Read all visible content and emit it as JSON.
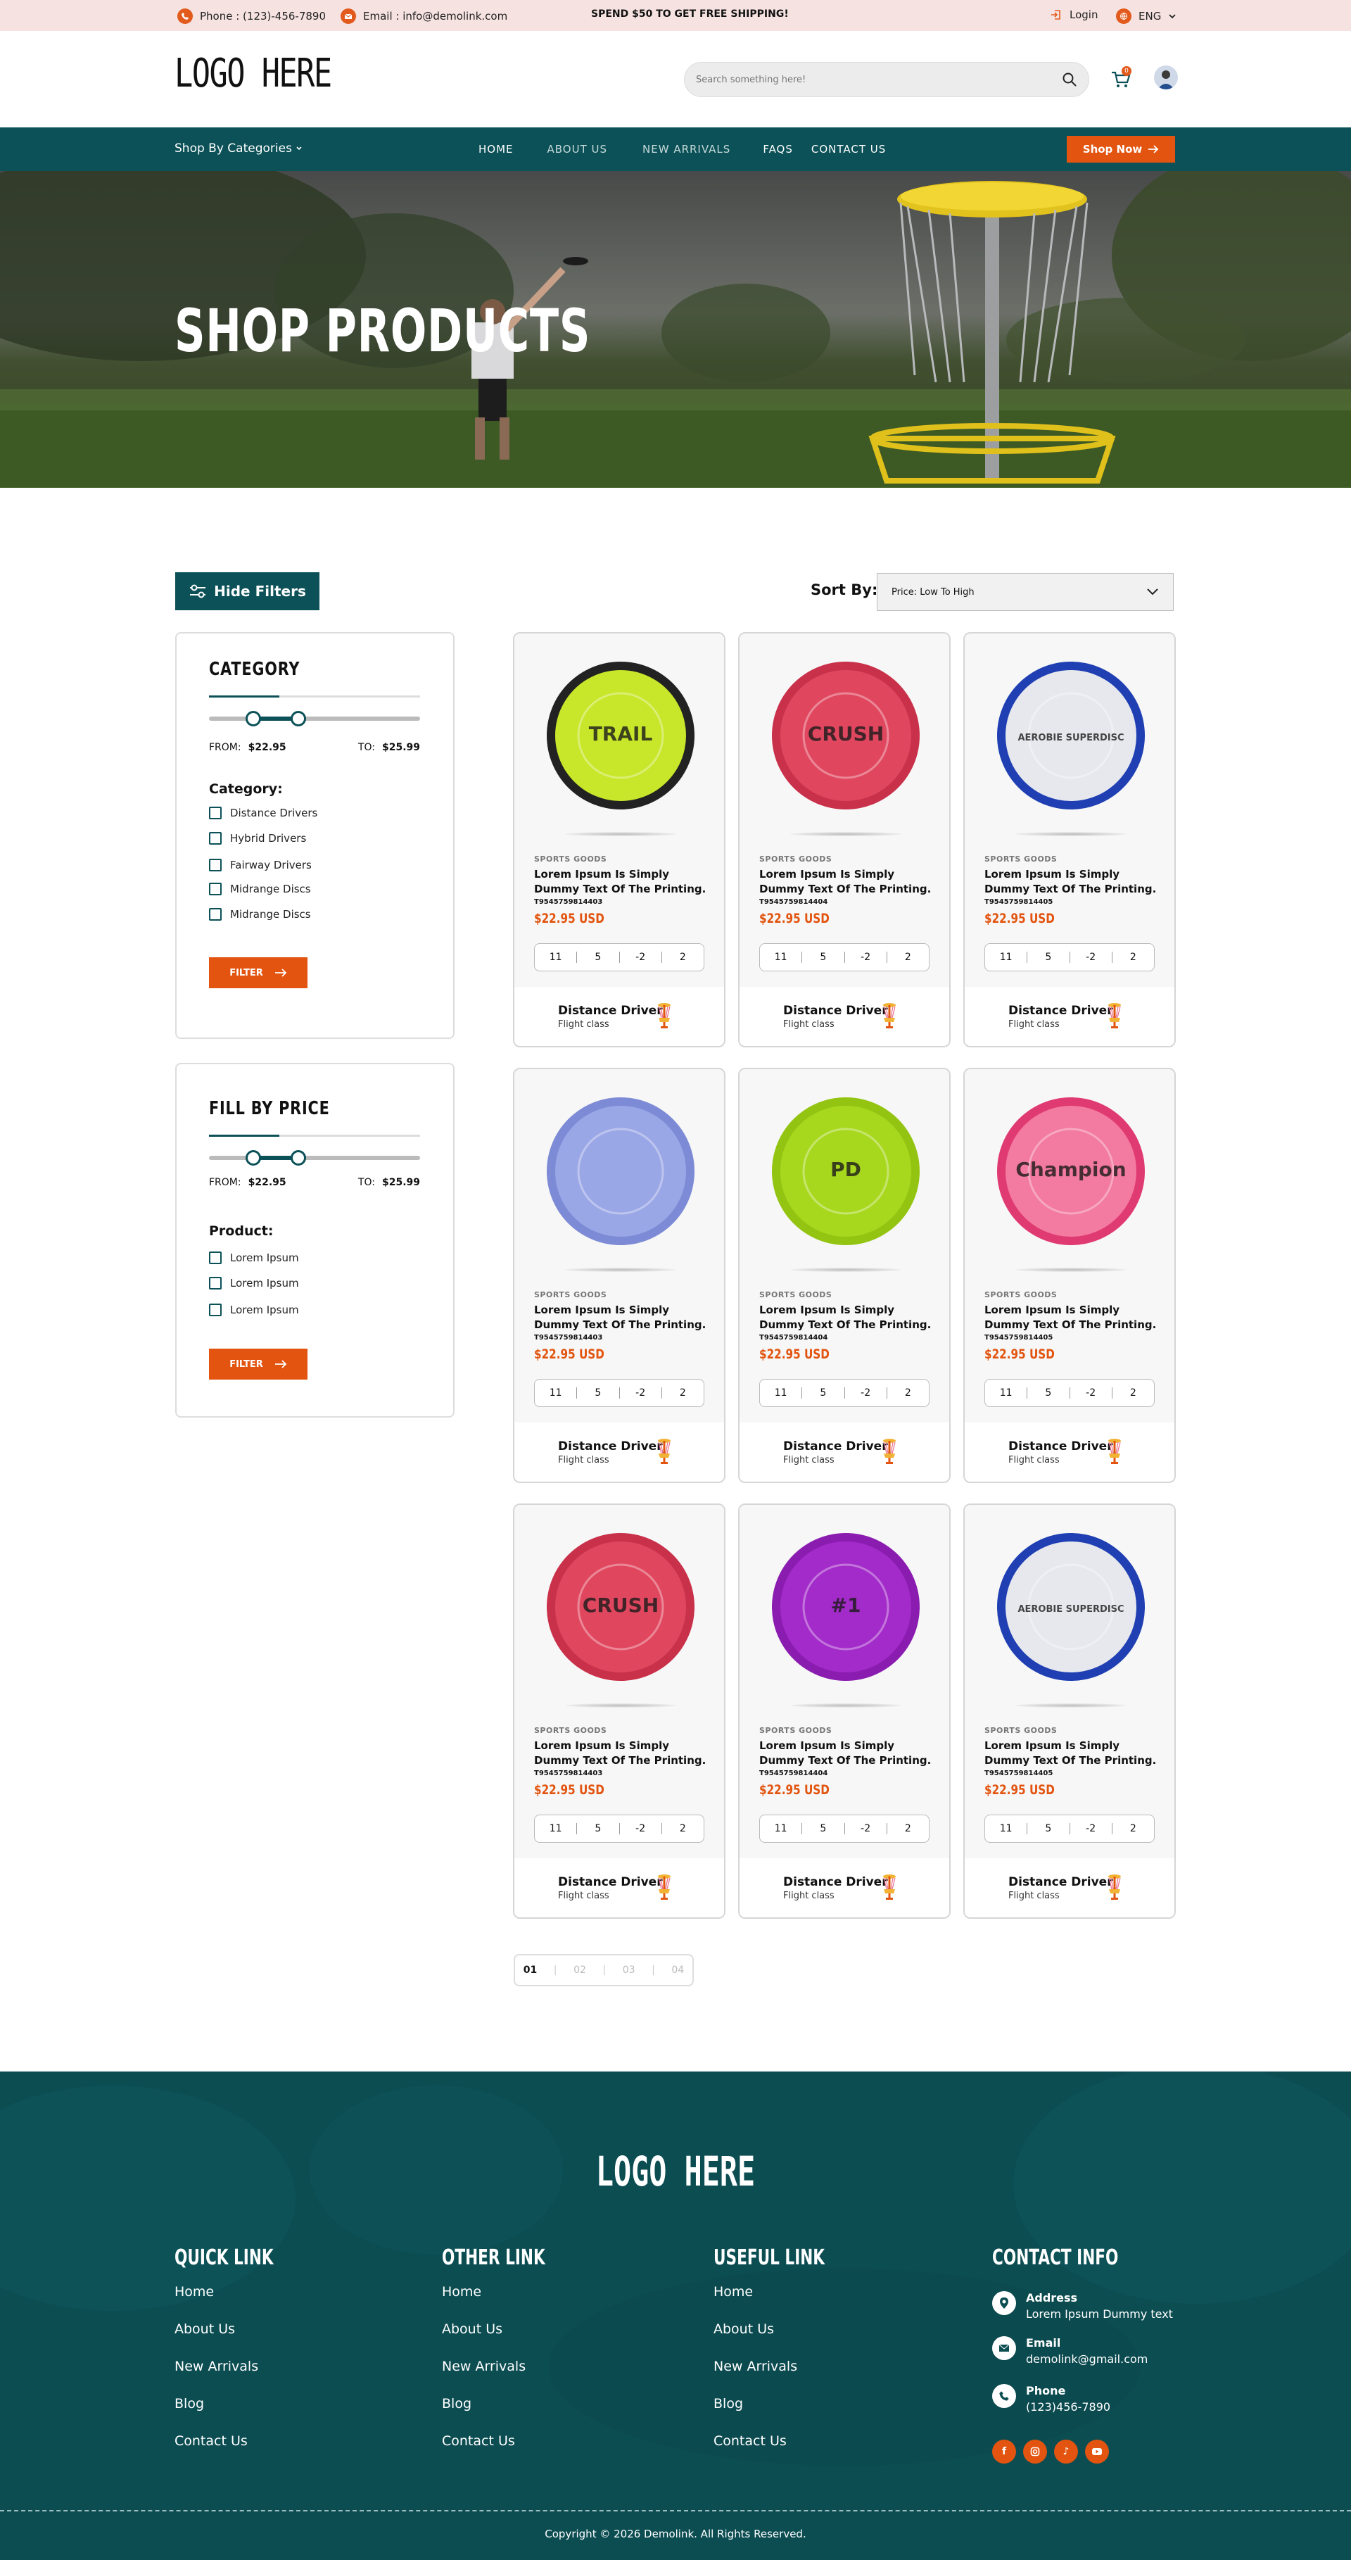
{
  "topbar": {
    "phone": "Phone : (123)-456-7890",
    "email": "Email : info@demolink.com",
    "promo": "SPEND $50 TO GET FREE SHIPPING!",
    "login": "Login",
    "language": "ENG"
  },
  "header": {
    "logo": "LOGO HERE",
    "search_placeholder": "Search something here!",
    "cart_count": "0"
  },
  "nav": {
    "categories_label": "Shop By Categories",
    "links": [
      "HOME",
      "ABOUT US",
      "NEW ARRIVALS",
      "FAQS",
      "CONTACT US"
    ],
    "shop_now": "Shop Now"
  },
  "hero": {
    "title": "SHOP PRODUCTS"
  },
  "toolbar": {
    "hide_filters": "Hide Filters",
    "sort_label": "Sort By:",
    "sort_value": "Price: Low To High"
  },
  "filter_category": {
    "heading": "CATEGORY",
    "from_label": "FROM:",
    "from_value": "$22.95",
    "to_label": "TO:",
    "to_value": "$25.99",
    "sublabel": "Category:",
    "options": [
      "Distance Drivers",
      "Hybrid Drivers",
      "Fairway Drivers",
      "Midrange Discs",
      "Midrange Discs"
    ],
    "button": "FILTER"
  },
  "filter_price": {
    "heading": "FILL BY PRICE",
    "from_label": "FROM:",
    "from_value": "$22.95",
    "to_label": "TO:",
    "to_value": "$25.99",
    "sublabel": "Product:",
    "options": [
      "Lorem Ipsum",
      "Lorem Ipsum",
      "Lorem Ipsum"
    ],
    "button": "FILTER"
  },
  "products": [
    {
      "category": "SPORTS GOODS",
      "title": "Lorem Ipsum Is Simply Dummy Text Of The Printing.",
      "sku": "T9545759814403",
      "price": "$22.95 USD",
      "stats": [
        "11",
        "5",
        "-2",
        "2"
      ],
      "driver": "Distance Driver",
      "flight": "Flight class",
      "disc_color": "#c8e62a",
      "disc_rim": "#222222",
      "disc_label": "TRAIL"
    },
    {
      "category": "SPORTS GOODS",
      "title": "Lorem Ipsum Is Simply Dummy Text Of The Printing.",
      "sku": "T9545759814404",
      "price": "$22.95 USD",
      "stats": [
        "11",
        "5",
        "-2",
        "2"
      ],
      "driver": "Distance Driver",
      "flight": "Flight class",
      "disc_color": "#e0475f",
      "disc_rim": "#c9304a",
      "disc_label": "CRUSH"
    },
    {
      "category": "SPORTS GOODS",
      "title": "Lorem Ipsum Is Simply Dummy Text Of The Printing.",
      "sku": "T9545759814405",
      "price": "$22.95 USD",
      "stats": [
        "11",
        "5",
        "-2",
        "2"
      ],
      "driver": "Distance Driver",
      "flight": "Flight class",
      "disc_color": "#e6e8ee",
      "disc_rim": "#1f3fb3",
      "disc_label": "AEROBIE SUPERDISC"
    },
    {
      "category": "SPORTS GOODS",
      "title": "Lorem Ipsum Is Simply Dummy Text Of The Printing.",
      "sku": "T9545759814403",
      "price": "$22.95 USD",
      "stats": [
        "11",
        "5",
        "-2",
        "2"
      ],
      "driver": "Distance Driver",
      "flight": "Flight class",
      "disc_color": "#9aa7e6",
      "disc_rim": "#7d8ad6",
      "disc_label": ""
    },
    {
      "category": "SPORTS GOODS",
      "title": "Lorem Ipsum Is Simply Dummy Text Of The Printing.",
      "sku": "T9545759814404",
      "price": "$22.95 USD",
      "stats": [
        "11",
        "5",
        "-2",
        "2"
      ],
      "driver": "Distance Driver",
      "flight": "Flight class",
      "disc_color": "#a8d81e",
      "disc_rim": "#93c412",
      "disc_label": "PD"
    },
    {
      "category": "SPORTS GOODS",
      "title": "Lorem Ipsum Is Simply Dummy Text Of The Printing.",
      "sku": "T9545759814405",
      "price": "$22.95 USD",
      "stats": [
        "11",
        "5",
        "-2",
        "2"
      ],
      "driver": "Distance Driver",
      "flight": "Flight class",
      "disc_color": "#f37aa0",
      "disc_rim": "#e03a72",
      "disc_label": "Champion"
    },
    {
      "category": "SPORTS GOODS",
      "title": "Lorem Ipsum Is Simply Dummy Text Of The Printing.",
      "sku": "T9545759814403",
      "price": "$22.95 USD",
      "stats": [
        "11",
        "5",
        "-2",
        "2"
      ],
      "driver": "Distance Driver",
      "flight": "Flight class",
      "disc_color": "#e0475f",
      "disc_rim": "#c9304a",
      "disc_label": "CRUSH"
    },
    {
      "category": "SPORTS GOODS",
      "title": "Lorem Ipsum Is Simply Dummy Text Of The Printing.",
      "sku": "T9545759814404",
      "price": "$22.95 USD",
      "stats": [
        "11",
        "5",
        "-2",
        "2"
      ],
      "driver": "Distance Driver",
      "flight": "Flight class",
      "disc_color": "#a32bc9",
      "disc_rim": "#8a1cb0",
      "disc_label": "#1"
    },
    {
      "category": "SPORTS GOODS",
      "title": "Lorem Ipsum Is Simply Dummy Text Of The Printing.",
      "sku": "T9545759814405",
      "price": "$22.95 USD",
      "stats": [
        "11",
        "5",
        "-2",
        "2"
      ],
      "driver": "Distance Driver",
      "flight": "Flight class",
      "disc_color": "#e6e8ee",
      "disc_rim": "#1f3fb3",
      "disc_label": "AEROBIE SUPERDISC"
    }
  ],
  "pagination": [
    "01",
    "02",
    "03",
    "04"
  ],
  "footer": {
    "logo": "LOGO HERE",
    "quick": {
      "heading": "QUICK LINK",
      "links": [
        "Home",
        "About Us",
        "New Arrivals",
        "Blog",
        "Contact Us"
      ]
    },
    "other": {
      "heading": "OTHER LINK",
      "links": [
        "Home",
        "About Us",
        "New Arrivals",
        "Blog",
        "Contact Us"
      ]
    },
    "useful": {
      "heading": "USEFUL LINK",
      "links": [
        "Home",
        "About Us",
        "New Arrivals",
        "Blog",
        "Contact Us"
      ]
    },
    "contact": {
      "heading": "CONTACT INFO",
      "address_label": "Address",
      "address": "Lorem Ipsum Dummy text",
      "email_label": "Email",
      "email": "demolink@gmail.com",
      "phone_label": "Phone",
      "phone": "(123)456-7890"
    },
    "social": [
      "facebook-icon",
      "instagram-icon",
      "tiktok-icon",
      "youtube-icon"
    ],
    "copyright": "Copyright © 2026 Demolink. All Rights Reserved."
  },
  "colors": {
    "brand_teal": "#0b5157",
    "accent_orange": "#e2540f",
    "topbar_pink": "#f6e3e1"
  }
}
